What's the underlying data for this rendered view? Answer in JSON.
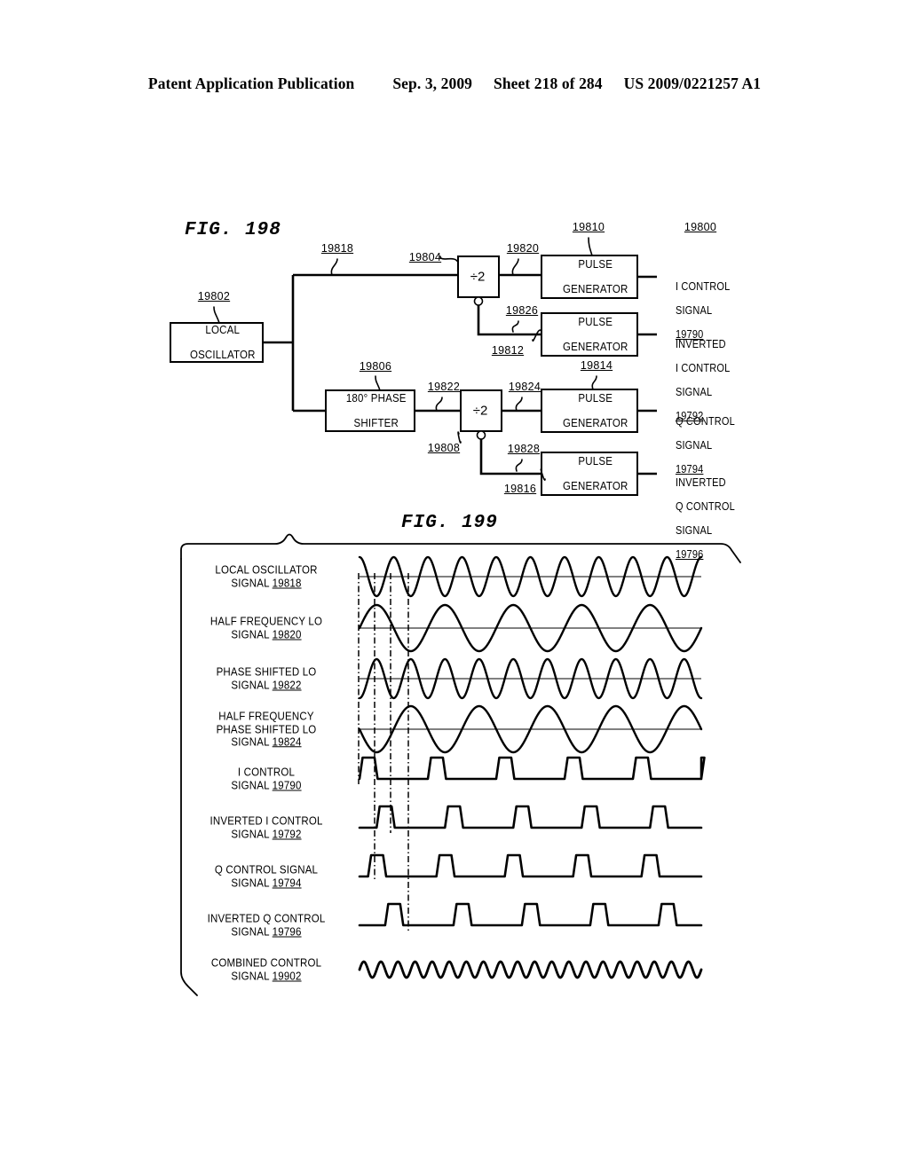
{
  "header": {
    "publication": "Patent Application Publication",
    "date": "Sep. 3, 2009",
    "sheet": "Sheet 218 of 284",
    "patent_number": "US 2009/0221257 A1"
  },
  "fig198": {
    "title": "FIG. 198",
    "system_ref": "19800",
    "blocks": {
      "local_oscillator": {
        "label": "LOCAL\nOSCILLATOR",
        "ref": "19802"
      },
      "phase_shifter": {
        "label": "180° PHASE\nSHIFTER",
        "ref": "19806"
      },
      "divider_1": {
        "label": "÷2",
        "ref": "19804"
      },
      "divider_2": {
        "label": "÷2",
        "ref": "19808"
      },
      "pulse_generator_1": {
        "label": "PULSE\nGENERATOR",
        "ref": "19810"
      },
      "pulse_generator_2": {
        "label": "PULSE\nGENERATOR",
        "ref": "19812"
      },
      "pulse_generator_3": {
        "label": "PULSE\nGENERATOR",
        "ref": "19814"
      },
      "pulse_generator_4": {
        "label": "PULSE\nGENERATOR",
        "ref": "19816"
      }
    },
    "net_refs": {
      "lo_signal": "19818",
      "half_freq_lo": "19820",
      "inverted_half_freq_lo": "19826",
      "phase_shifted_lo": "19822",
      "half_freq_phase_shifted_lo": "19824",
      "inverted_half_freq_phase_shifted_lo": "19828"
    },
    "outputs": [
      {
        "name": "i-control-signal",
        "line1": "I CONTROL",
        "line2": "SIGNAL",
        "ref": "19790"
      },
      {
        "name": "inverted-i-control-signal",
        "line1": "INVERTED",
        "line2": "I CONTROL",
        "line3": "SIGNAL",
        "ref": "19792"
      },
      {
        "name": "q-control-signal",
        "line1": "Q CONTROL",
        "line2": "SIGNAL",
        "ref": "19794"
      },
      {
        "name": "inverted-q-control-signal",
        "line1": "INVERTED",
        "line2": "Q CONTROL",
        "line3": "SIGNAL",
        "ref": "19796"
      }
    ]
  },
  "fig199": {
    "title": "FIG. 199",
    "waveforms": [
      {
        "name": "local-oscillator-signal",
        "label": "LOCAL OSCILLATOR\nSIGNAL ",
        "ref": "19818",
        "kind": "sine",
        "cycles": 10,
        "phase_deg": 90
      },
      {
        "name": "half-frequency-lo-signal",
        "label": "HALF FREQUENCY LO\nSIGNAL ",
        "ref": "19820",
        "kind": "sine",
        "cycles": 5,
        "phase_deg": 0
      },
      {
        "name": "phase-shifted-lo-signal",
        "label": "PHASE SHIFTED LO\nSIGNAL ",
        "ref": "19822",
        "kind": "sine",
        "cycles": 10,
        "phase_deg": 270
      },
      {
        "name": "half-frequency-phase-shifted-lo-signal",
        "label": "HALF FREQUENCY\nPHASE SHIFTED LO\nSIGNAL ",
        "ref": "19824",
        "kind": "sine",
        "cycles": 5,
        "phase_deg": 180
      },
      {
        "name": "i-control-signal",
        "label": "I CONTROL\nSIGNAL ",
        "ref": "19790",
        "kind": "pulse",
        "pulses": 5,
        "offset_frac": 0.0
      },
      {
        "name": "inverted-i-control-signal",
        "label": "INVERTED I CONTROL\nSIGNAL ",
        "ref": "19792",
        "kind": "pulse",
        "pulses": 5,
        "offset_frac": 0.25
      },
      {
        "name": "q-control-signal",
        "label": "Q CONTROL SIGNAL\nSIGNAL ",
        "ref": "19794",
        "kind": "pulse",
        "pulses": 5,
        "offset_frac": 0.125
      },
      {
        "name": "inverted-q-control-signal",
        "label": "INVERTED Q CONTROL\nSIGNAL ",
        "ref": "19796",
        "kind": "pulse",
        "pulses": 5,
        "offset_frac": 0.375
      },
      {
        "name": "combined-control-signal",
        "label": "COMBINED CONTROL\nSIGNAL ",
        "ref": "19902",
        "kind": "ripple",
        "cycles": 20,
        "phase_deg": 0
      }
    ]
  }
}
